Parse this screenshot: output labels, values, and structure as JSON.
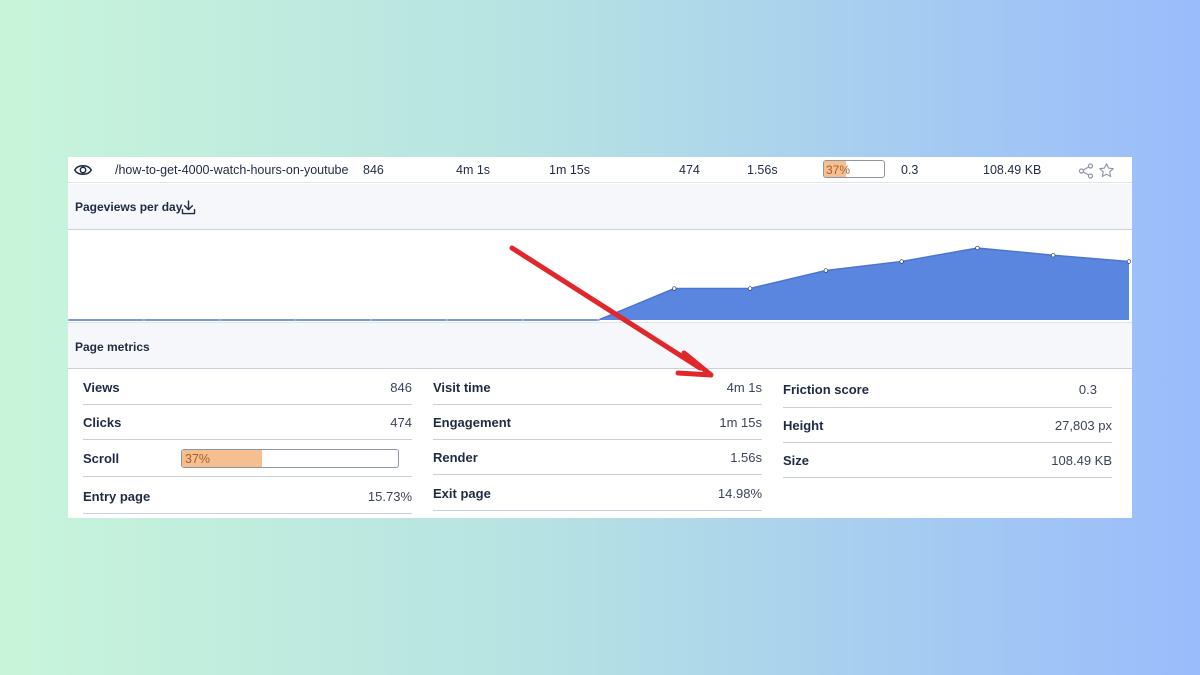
{
  "top_row": {
    "path": "/how-to-get-4000-watch-hours-on-youtube",
    "views": "846",
    "visit_time": "4m 1s",
    "engagement": "1m 15s",
    "clicks": "474",
    "render": "1.56s",
    "scroll_percent": 37,
    "scroll_label": "37%",
    "friction": "0.3",
    "size": "108.49 KB",
    "icons": [
      "eye-icon",
      "share-icon",
      "star-icon"
    ]
  },
  "pageviews": {
    "title": "Pageviews per day",
    "icon": "download-icon"
  },
  "chart_data": {
    "type": "area",
    "x": [
      0,
      1,
      2,
      3,
      4,
      5,
      6,
      7,
      8,
      9,
      10,
      11,
      12,
      13,
      14
    ],
    "values": [
      0,
      0,
      0,
      0,
      0,
      0,
      0,
      0,
      35,
      35,
      55,
      65,
      80,
      72,
      65
    ],
    "title": "",
    "xlabel": "",
    "ylabel": "",
    "ylim": [
      0,
      100
    ],
    "grid": false,
    "color": "#5b86e0",
    "line_color": "#4c75d1"
  },
  "page_metrics": {
    "title": "Page metrics",
    "col1": [
      {
        "label": "Views",
        "value": "846"
      },
      {
        "label": "Clicks",
        "value": "474"
      },
      {
        "label": "Scroll",
        "value": "",
        "percent": 37,
        "percent_label": "37%"
      },
      {
        "label": "Entry page",
        "value": "15.73%"
      }
    ],
    "col2": [
      {
        "label": "Visit time",
        "value": "4m 1s"
      },
      {
        "label": "Engagement",
        "value": "1m 15s"
      },
      {
        "label": "Render",
        "value": "1.56s"
      },
      {
        "label": "Exit page",
        "value": "14.98%"
      }
    ],
    "col3": [
      {
        "label": "Friction score",
        "value": "0.3"
      },
      {
        "label": "Height",
        "value": "27,803 px"
      },
      {
        "label": "Size",
        "value": "108.49 KB"
      }
    ]
  },
  "colors": {
    "accent": "#5b86e0",
    "progress_fill": "#f6bf8f",
    "arrow": "#e0272b"
  }
}
